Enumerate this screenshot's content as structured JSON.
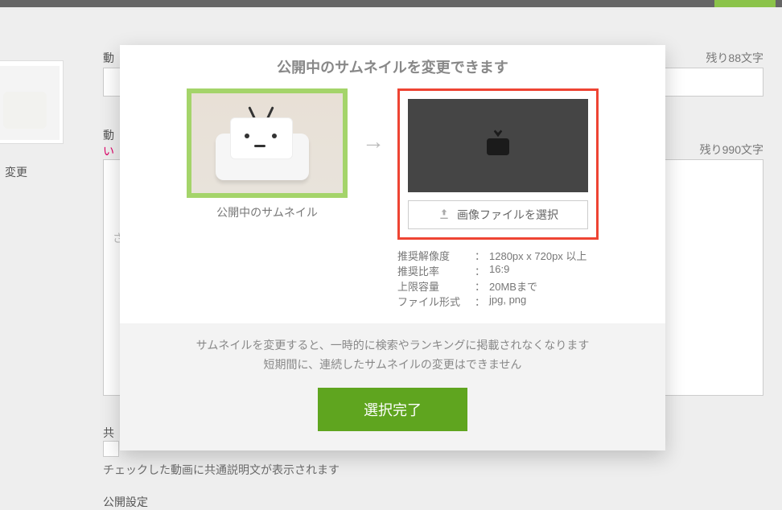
{
  "background": {
    "label_video_title_prefix": "動",
    "counter_title": "残り88文字",
    "label_video_desc_prefix": "動",
    "desc_hint_prefix": "い",
    "counter_desc": "残り990文字",
    "sidebar_change": "変更",
    "field_hint_prefix": "さ",
    "shared_prefix": "共",
    "check_note": "チェックした動画に共通説明文が表示されます",
    "publish_setting": "公開設定"
  },
  "modal": {
    "title": "公開中のサムネイルを変更できます",
    "current_caption": "公開中のサムネイル",
    "pick_button": "画像ファイルを選択",
    "spec": {
      "res_k": "推奨解像度",
      "res_v": "1280px x 720px 以上",
      "ratio_k": "推奨比率",
      "ratio_v": "16:9",
      "size_k": "上限容量",
      "size_v": "20MBまで",
      "fmt_k": "ファイル形式",
      "fmt_v": "jpg, png",
      "colon": "："
    },
    "note_line1": "サムネイルを変更すると、一時的に検索やランキングに掲載されなくなります",
    "note_line2": "短期間に、連続したサムネイルの変更はできません",
    "submit": "選択完了"
  }
}
